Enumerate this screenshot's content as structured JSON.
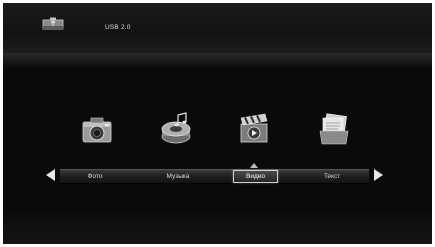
{
  "header": {
    "device_label": "USB 2.0",
    "device_icon": "usb-drive-icon"
  },
  "menu": {
    "items": [
      {
        "label": "Фото",
        "icon": "camera-icon",
        "selected": false
      },
      {
        "label": "Музыка",
        "icon": "music-player-icon",
        "selected": false
      },
      {
        "label": "Видео",
        "icon": "film-clapper-icon",
        "selected": true
      },
      {
        "label": "Текст",
        "icon": "documents-icon",
        "selected": false
      }
    ]
  },
  "navigation": {
    "left_arrow_icon": "arrow-left-icon",
    "right_arrow_icon": "arrow-right-icon"
  },
  "colors": {
    "background": "#0a0a0a",
    "text": "#dcdcdc",
    "highlight_border": "#cfcfcf"
  }
}
